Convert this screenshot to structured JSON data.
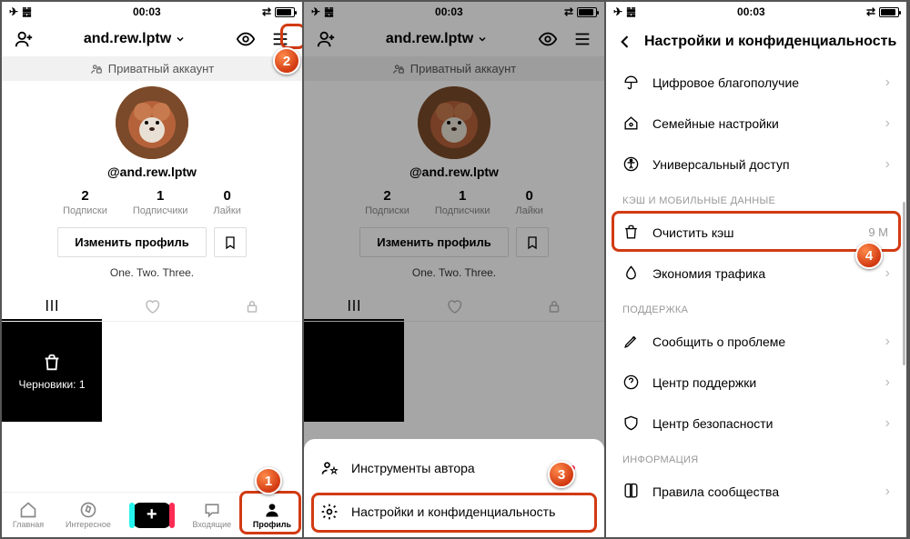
{
  "status": {
    "time": "00:03"
  },
  "profile": {
    "username_display": "and.rew.lptw",
    "private_label": "Приватный аккаунт",
    "handle": "@and.rew.lptw",
    "stats": [
      {
        "num": "2",
        "lbl": "Подписки"
      },
      {
        "num": "1",
        "lbl": "Подписчики"
      },
      {
        "num": "0",
        "lbl": "Лайки"
      }
    ],
    "edit_label": "Изменить профиль",
    "bio": "One. Two. Three.",
    "drafts_label": "Черновики: 1"
  },
  "nav": {
    "home": "Главная",
    "discover": "Интересное",
    "inbox": "Входящие",
    "profile": "Профиль"
  },
  "sheet": {
    "creator_tools": "Инструменты автора",
    "settings": "Настройки и конфиденциальность"
  },
  "settings": {
    "title": "Настройки и конфиденциальность",
    "digital": "Цифровое благополучие",
    "family": "Семейные настройки",
    "access": "Универсальный доступ",
    "sec_cache": "КЭШ И МОБИЛЬНЫЕ ДАННЫЕ",
    "clear_cache": "Очистить кэш",
    "cache_size": "9 M",
    "data_saver": "Экономия трафика",
    "sec_support": "ПОДДЕРЖКА",
    "report": "Сообщить о проблеме",
    "help": "Центр поддержки",
    "safety": "Центр безопасности",
    "sec_info": "ИНФОРМАЦИЯ",
    "guidelines": "Правила сообщества"
  },
  "markers": {
    "m1": "1",
    "m2": "2",
    "m3": "3",
    "m4": "4"
  }
}
